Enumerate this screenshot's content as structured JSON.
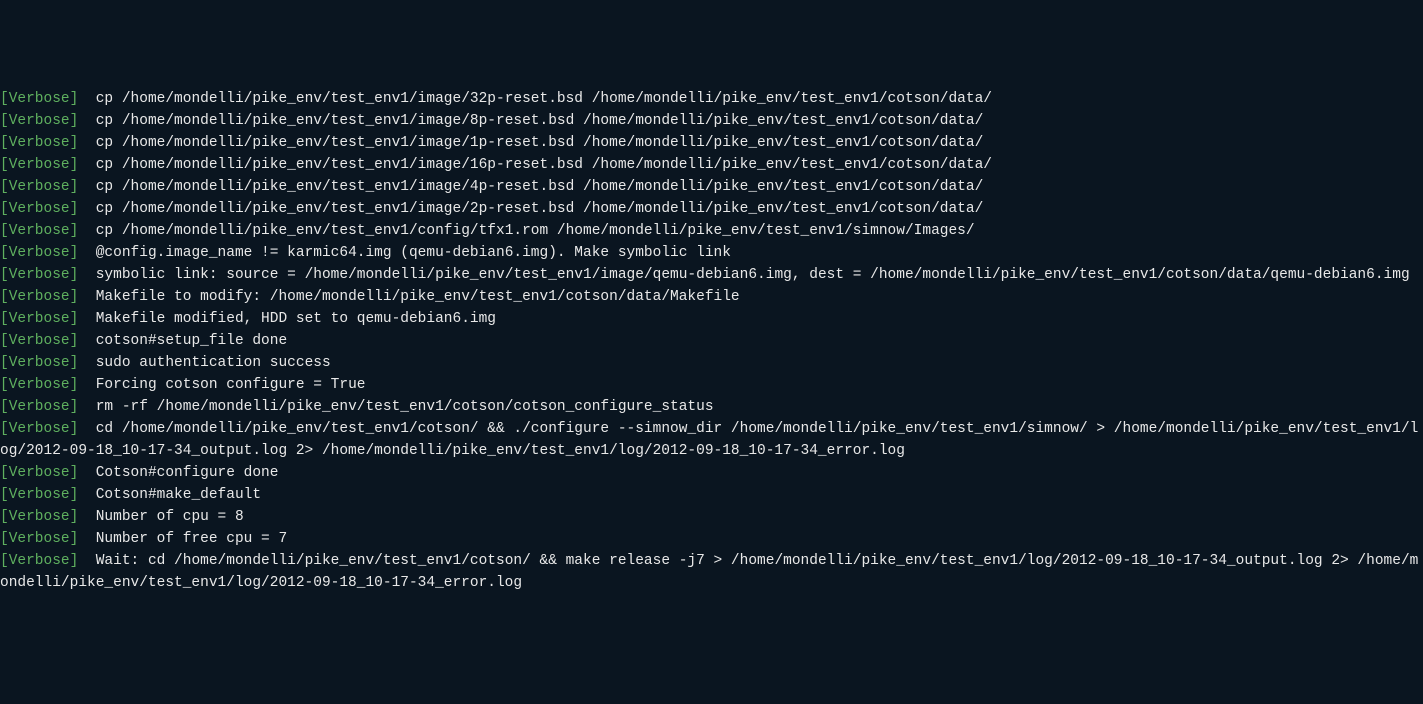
{
  "tag": "[Verbose]",
  "lines": [
    {
      "prefix": true,
      "text": "  cp /home/mondelli/pike_env/test_env1/image/32p-reset.bsd /home/mondelli/pike_env/test_env1/cotson/data/"
    },
    {
      "prefix": true,
      "text": "  cp /home/mondelli/pike_env/test_env1/image/8p-reset.bsd /home/mondelli/pike_env/test_env1/cotson/data/"
    },
    {
      "prefix": true,
      "text": "  cp /home/mondelli/pike_env/test_env1/image/1p-reset.bsd /home/mondelli/pike_env/test_env1/cotson/data/"
    },
    {
      "prefix": true,
      "text": "  cp /home/mondelli/pike_env/test_env1/image/16p-reset.bsd /home/mondelli/pike_env/test_env1/cotson/data/"
    },
    {
      "prefix": true,
      "text": "  cp /home/mondelli/pike_env/test_env1/image/4p-reset.bsd /home/mondelli/pike_env/test_env1/cotson/data/"
    },
    {
      "prefix": true,
      "text": "  cp /home/mondelli/pike_env/test_env1/image/2p-reset.bsd /home/mondelli/pike_env/test_env1/cotson/data/"
    },
    {
      "prefix": true,
      "text": "  cp /home/mondelli/pike_env/test_env1/config/tfx1.rom /home/mondelli/pike_env/test_env1/simnow/Images/"
    },
    {
      "prefix": true,
      "text": "  @config.image_name != karmic64.img (qemu-debian6.img). Make symbolic link"
    },
    {
      "prefix": true,
      "text": "  symbolic link: source = /home/mondelli/pike_env/test_env1/image/qemu-debian6.img, dest = /home/mondelli/pike_env/test_env1/cotson/data/qemu-debian6.img",
      "wrap": true
    },
    {
      "prefix": true,
      "text": "  Makefile to modify: /home/mondelli/pike_env/test_env1/cotson/data/Makefile"
    },
    {
      "prefix": true,
      "text": "  Makefile modified, HDD set to qemu-debian6.img"
    },
    {
      "prefix": true,
      "text": "  cotson#setup_file done"
    },
    {
      "prefix": true,
      "text": "  sudo authentication success"
    },
    {
      "prefix": true,
      "text": "  Forcing cotson configure = True"
    },
    {
      "prefix": true,
      "text": "  rm -rf /home/mondelli/pike_env/test_env1/cotson/cotson_configure_status"
    },
    {
      "prefix": true,
      "text": "  cd /home/mondelli/pike_env/test_env1/cotson/ && ./configure --simnow_dir /home/mondelli/pike_env/test_env1/simnow/ > /home/mondelli/pike_env/test_env1/log/2012-09-18_10-17-34_output.log 2> /home/mondelli/pike_env/test_env1/log/2012-09-18_10-17-34_error.log",
      "wrap": true
    },
    {
      "prefix": true,
      "text": "  Cotson#configure done"
    },
    {
      "prefix": true,
      "text": "  Cotson#make_default"
    },
    {
      "prefix": true,
      "text": "  Number of cpu = 8"
    },
    {
      "prefix": true,
      "text": "  Number of free cpu = 7"
    },
    {
      "prefix": true,
      "text": "  Wait: cd /home/mondelli/pike_env/test_env1/cotson/ && make release -j7 > /home/mondelli/pike_env/test_env1/log/2012-09-18_10-17-34_output.log 2> /home/mondelli/pike_env/test_env1/log/2012-09-18_10-17-34_error.log",
      "wrap": true
    }
  ]
}
